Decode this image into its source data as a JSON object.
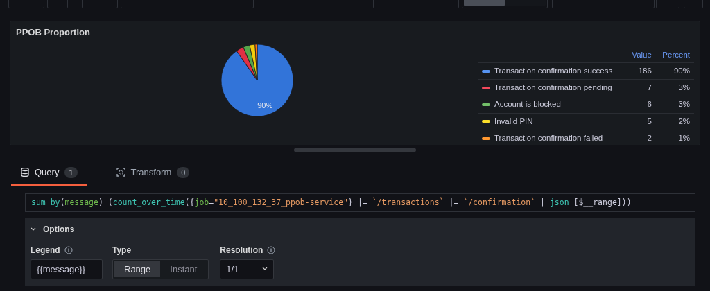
{
  "panel": {
    "title": "PPOB Proportion",
    "chart_data": {
      "type": "pie",
      "categories": [
        "Transaction confirmation success",
        "Transaction confirmation pending",
        "Account is blocked",
        "Invalid PIN",
        "Transaction confirmation failed"
      ],
      "values": [
        90.29,
        3.4,
        2.91,
        2.43,
        0.97
      ],
      "colors": [
        "#3274d9",
        "#e02f44",
        "#56a64b",
        "#f2cc0c",
        "#ff780a"
      ],
      "value_labels": [
        "90%",
        null,
        null,
        null,
        null
      ]
    },
    "legend": {
      "columns": [
        "Value",
        "Percent"
      ],
      "rows": [
        {
          "value": "186",
          "percent": "90%",
          "color": "#5794f2"
        },
        {
          "value": "7",
          "percent": "3%",
          "color": "#f2495c"
        },
        {
          "value": "6",
          "percent": "3%",
          "color": "#73bf69"
        },
        {
          "value": "5",
          "percent": "2%",
          "color": "#fade2a"
        },
        {
          "value": "2",
          "percent": "1%",
          "color": "#ff9830"
        }
      ]
    }
  },
  "view_switch": [
    {
      "selected": true
    },
    {
      "selected": false
    }
  ],
  "tabs": [
    {
      "label": "Query",
      "count": "1",
      "selected": true,
      "kind": "query"
    },
    {
      "label": "Transform",
      "count": "0",
      "selected": false,
      "kind": "transform"
    }
  ],
  "query": [
    {
      "t": "sum by",
      "kind": "fn"
    },
    {
      "t": "(",
      "kind": "p"
    },
    {
      "t": "message",
      "kind": "lbl"
    },
    {
      "t": ") (",
      "kind": "p"
    },
    {
      "t": "count_over_time",
      "kind": "fn"
    },
    {
      "t": "({",
      "kind": "p"
    },
    {
      "t": "job",
      "kind": "lbl"
    },
    {
      "t": "=",
      "kind": "p"
    },
    {
      "t": "\"10_100_132_37_ppob-service\"",
      "kind": "str"
    },
    {
      "t": "} |= ",
      "kind": "p"
    },
    {
      "t": "`/transactions`",
      "kind": "str"
    },
    {
      "t": " |= ",
      "kind": "p"
    },
    {
      "t": "`/confirmation`",
      "kind": "str"
    },
    {
      "t": " | ",
      "kind": "p"
    },
    {
      "t": "json",
      "kind": "fn"
    },
    {
      "t": " [$__range]))",
      "kind": "p"
    }
  ],
  "options": {
    "title": "Options",
    "expanded": true,
    "legend": {
      "label": "Legend",
      "value": "{{message}}"
    },
    "type": {
      "label": "Type",
      "choices": [
        {
          "label": "Range",
          "selected": true
        },
        {
          "label": "Instant",
          "selected": false
        }
      ]
    },
    "resolution": {
      "label": "Resolution",
      "value": "1/1"
    }
  }
}
